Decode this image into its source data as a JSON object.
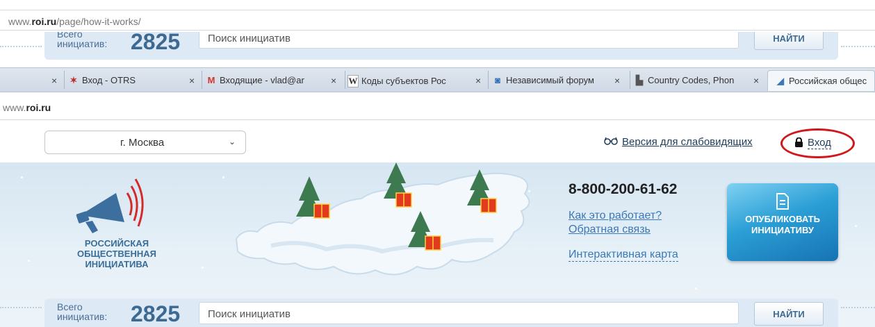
{
  "top_url": {
    "prefix": "www.",
    "domain": "roi.ru",
    "path": "/page/how-it-works/"
  },
  "search_top": {
    "label_line1": "Всего",
    "label_line2": "инициатив:",
    "count": "2825",
    "placeholder": "Поиск инициатив",
    "button": "НАЙТИ"
  },
  "tabs": [
    {
      "close": "×",
      "icon": "otrs-icon",
      "title": "Вход - OTRS"
    },
    {
      "close": "×",
      "icon": "gmail-icon",
      "title": "Входящие - vlad@ar"
    },
    {
      "close": "×",
      "icon": "wikipedia-icon",
      "title": "Коды субъектов Рос"
    },
    {
      "close": "×",
      "icon": "forum-icon",
      "title": "Независимый форум"
    },
    {
      "close": "×",
      "icon": "document-icon",
      "title": "Country Codes, Phon"
    },
    {
      "close": "×",
      "icon": "roi-icon",
      "title": "Российская общес"
    }
  ],
  "mid_url": {
    "prefix": "www.",
    "domain": "roi.ru"
  },
  "header": {
    "city": "г. Москва",
    "accessibility": "Версия для слабовидящих",
    "login": "Вход"
  },
  "banner": {
    "org_name_lines": [
      "РОССИЙСКАЯ",
      "ОБЩЕСТВЕННАЯ",
      "ИНИЦИАТИВА"
    ],
    "phone": "8-800-200-61-62",
    "link_how": "Как это работает?",
    "link_feedback": "Обратная связь",
    "link_map": "Интерактивная карта",
    "publish_line1": "ОПУБЛИКОВАТЬ",
    "publish_line2": "ИНИЦИАТИВУ"
  },
  "search_bottom": {
    "label_line1": "Всего",
    "label_line2": "инициатив:",
    "count": "2825",
    "placeholder": "Поиск инициатив",
    "button": "НАЙТИ"
  },
  "colors": {
    "accent": "#3a6d98",
    "link": "#3a78b6",
    "highlight_ring": "#d0181c",
    "publish_button": "#2b9fd6"
  }
}
